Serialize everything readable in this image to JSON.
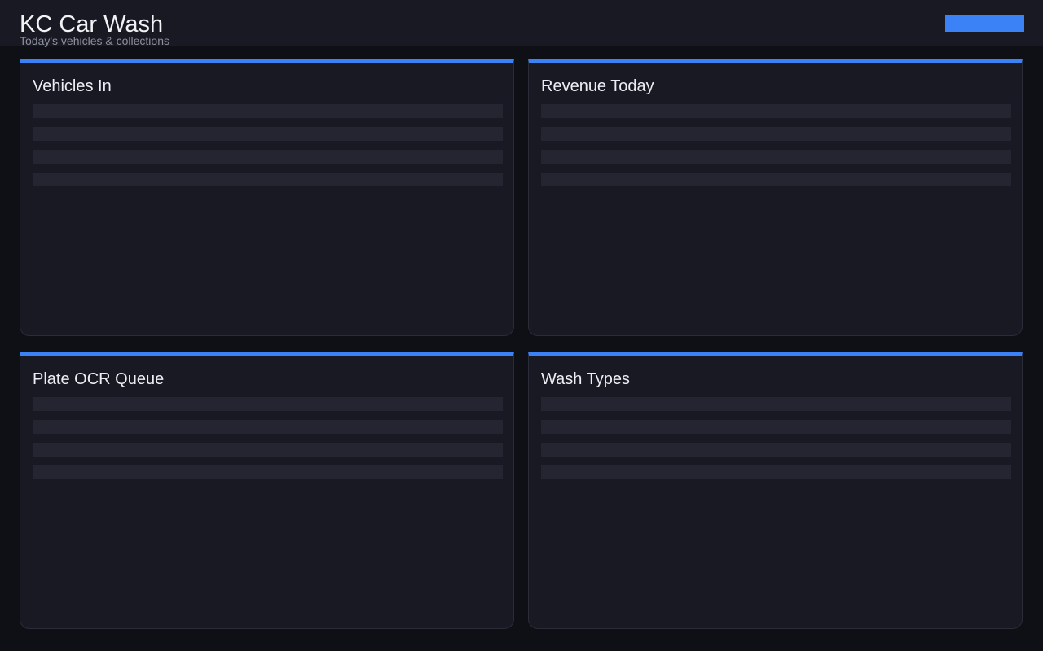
{
  "header": {
    "title": "KC Car Wash",
    "subtitle": "Today's vehicles & collections",
    "action_label": ""
  },
  "panels": [
    {
      "title": "Vehicles In"
    },
    {
      "title": "Revenue Today"
    },
    {
      "title": "Plate OCR Queue"
    },
    {
      "title": "Wash Types"
    }
  ],
  "colors": {
    "accent": "#3b82f6",
    "background": "#0f1015",
    "surface": "#181922",
    "skeleton": "#242531"
  }
}
